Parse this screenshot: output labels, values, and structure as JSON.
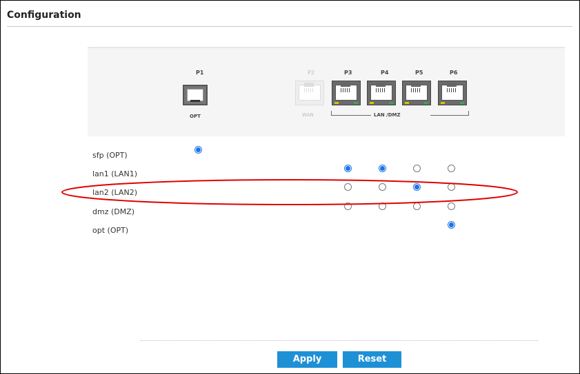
{
  "title": "Configuration",
  "ports": {
    "p1": {
      "label": "P1",
      "sub": "OPT"
    },
    "p2": {
      "label": "P2",
      "sub": "WAN"
    },
    "p3": {
      "label": "P3"
    },
    "p4": {
      "label": "P4"
    },
    "p5": {
      "label": "P5"
    },
    "p6": {
      "label": "P6"
    },
    "group_label": "LAN /DMZ"
  },
  "rows": [
    {
      "label": "sfp (OPT)",
      "selected": [
        "P1"
      ]
    },
    {
      "label": "lan1 (LAN1)",
      "selected": [
        "P3",
        "P4"
      ]
    },
    {
      "label": "lan2 (LAN2)",
      "selected": [
        "P5"
      ]
    },
    {
      "label": "dmz (DMZ)",
      "selected": []
    },
    {
      "label": "opt (OPT)",
      "selected": [
        "P6"
      ]
    }
  ],
  "buttons": {
    "apply": "Apply",
    "reset": "Reset"
  },
  "colors": {
    "accent": "#1e90d6",
    "radio_selected": "#1a73e8",
    "highlight": "#e00000"
  }
}
